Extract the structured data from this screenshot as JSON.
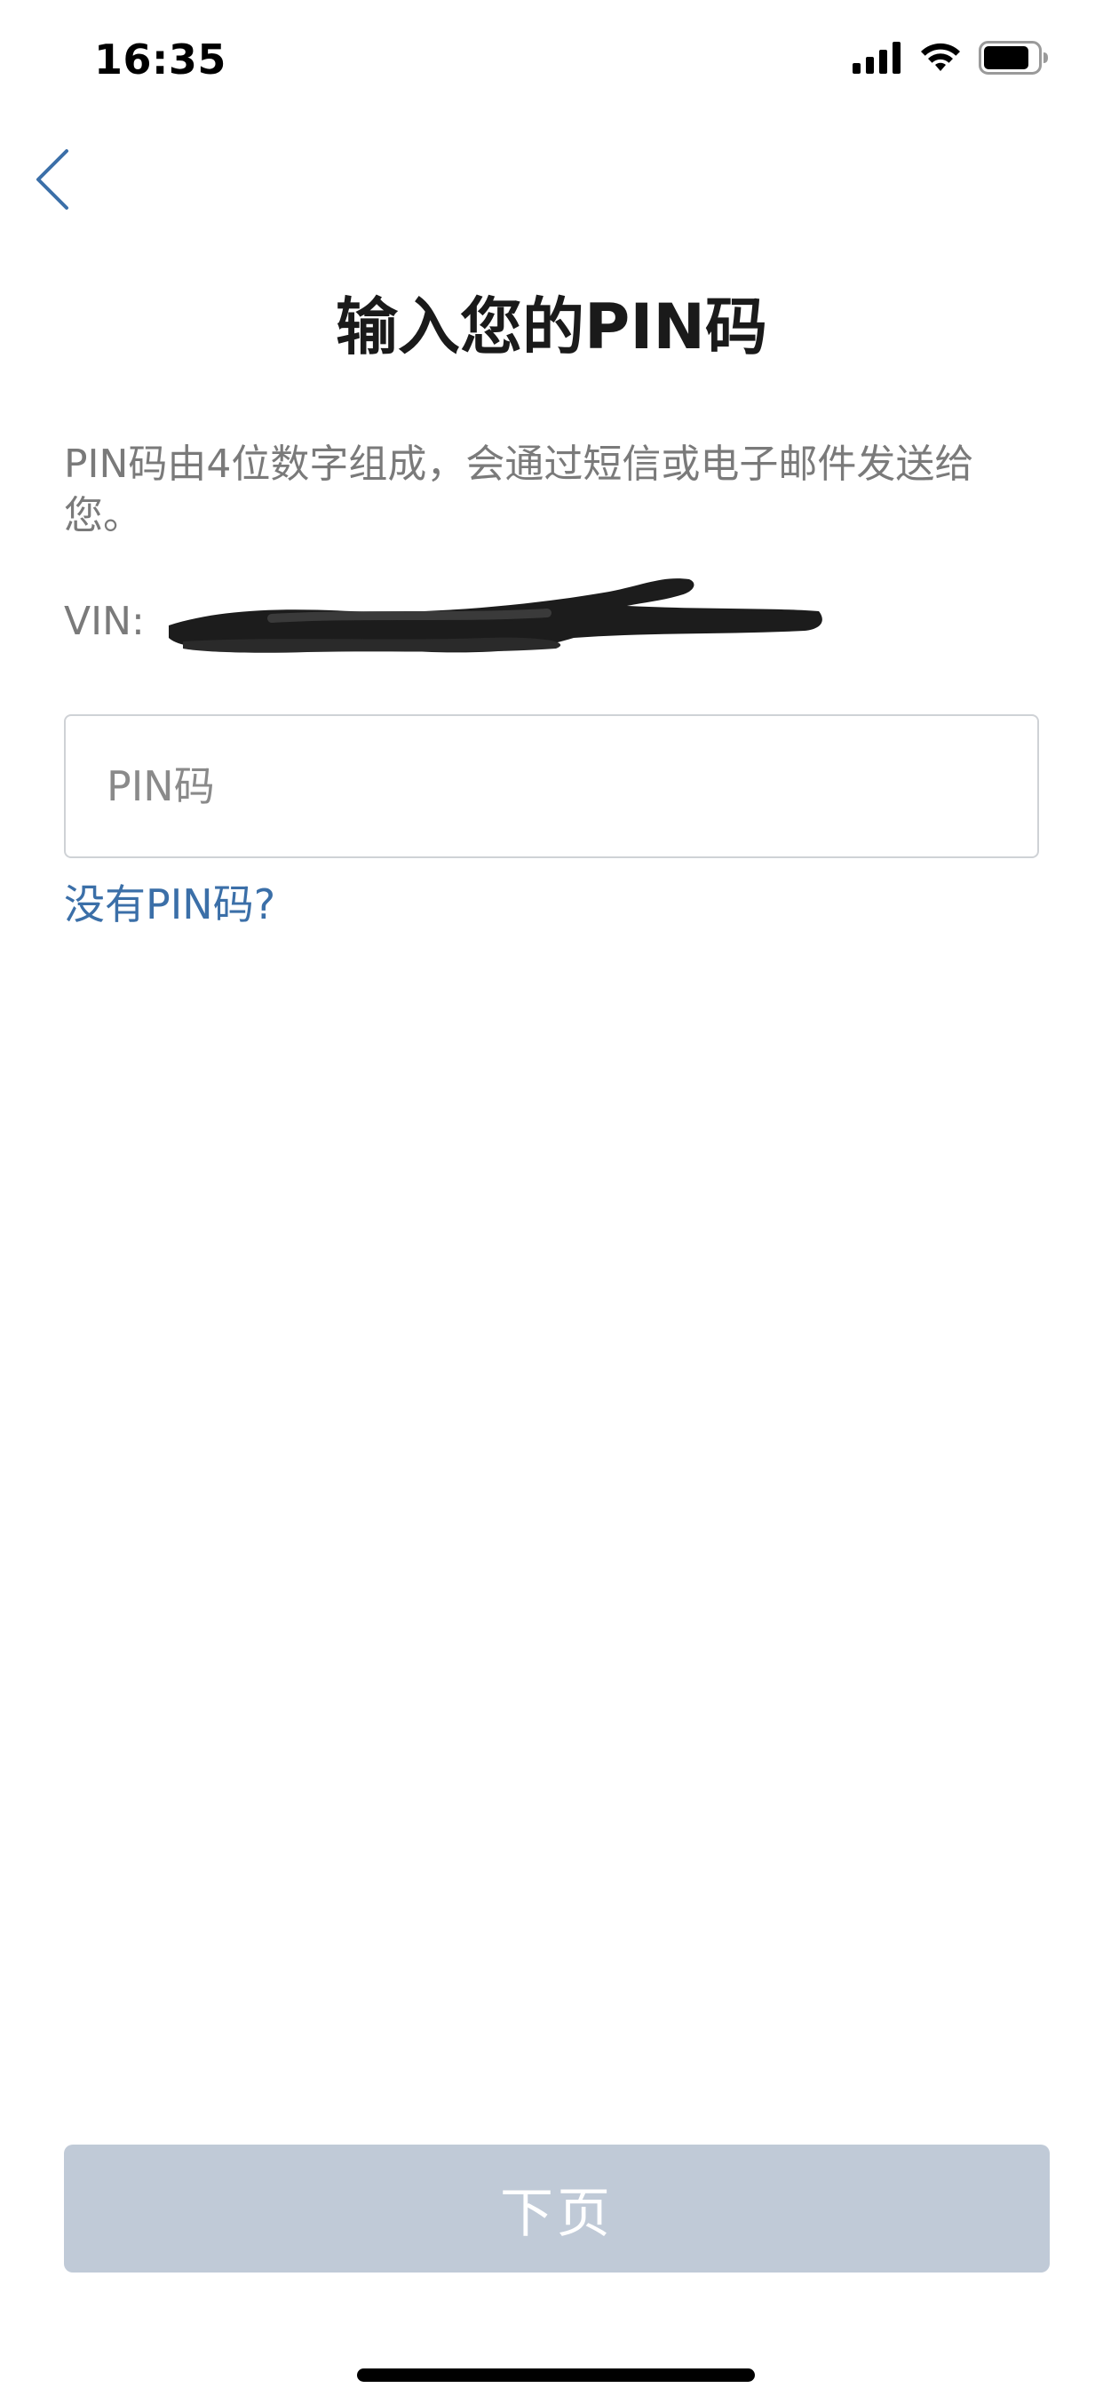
{
  "status_bar": {
    "time": "16:35",
    "icons": [
      "cellular-signal-icon",
      "wifi-icon",
      "battery-icon"
    ]
  },
  "nav": {
    "back_icon": "chevron-left-icon"
  },
  "page": {
    "title": "输入您的PIN码",
    "description": "PIN码由4位数字组成，会通过短信或电子邮件发送给您。",
    "vin_label": "VIN: "
  },
  "pin_input": {
    "placeholder": "PIN码",
    "value": ""
  },
  "links": {
    "no_pin": "没有PIN码?"
  },
  "footer": {
    "next_label": "下页"
  },
  "colors": {
    "accent": "#3b6fa8",
    "button_disabled": "#c0cad7",
    "secondary_text": "#7a7a7a",
    "border": "#cfd2d6"
  }
}
